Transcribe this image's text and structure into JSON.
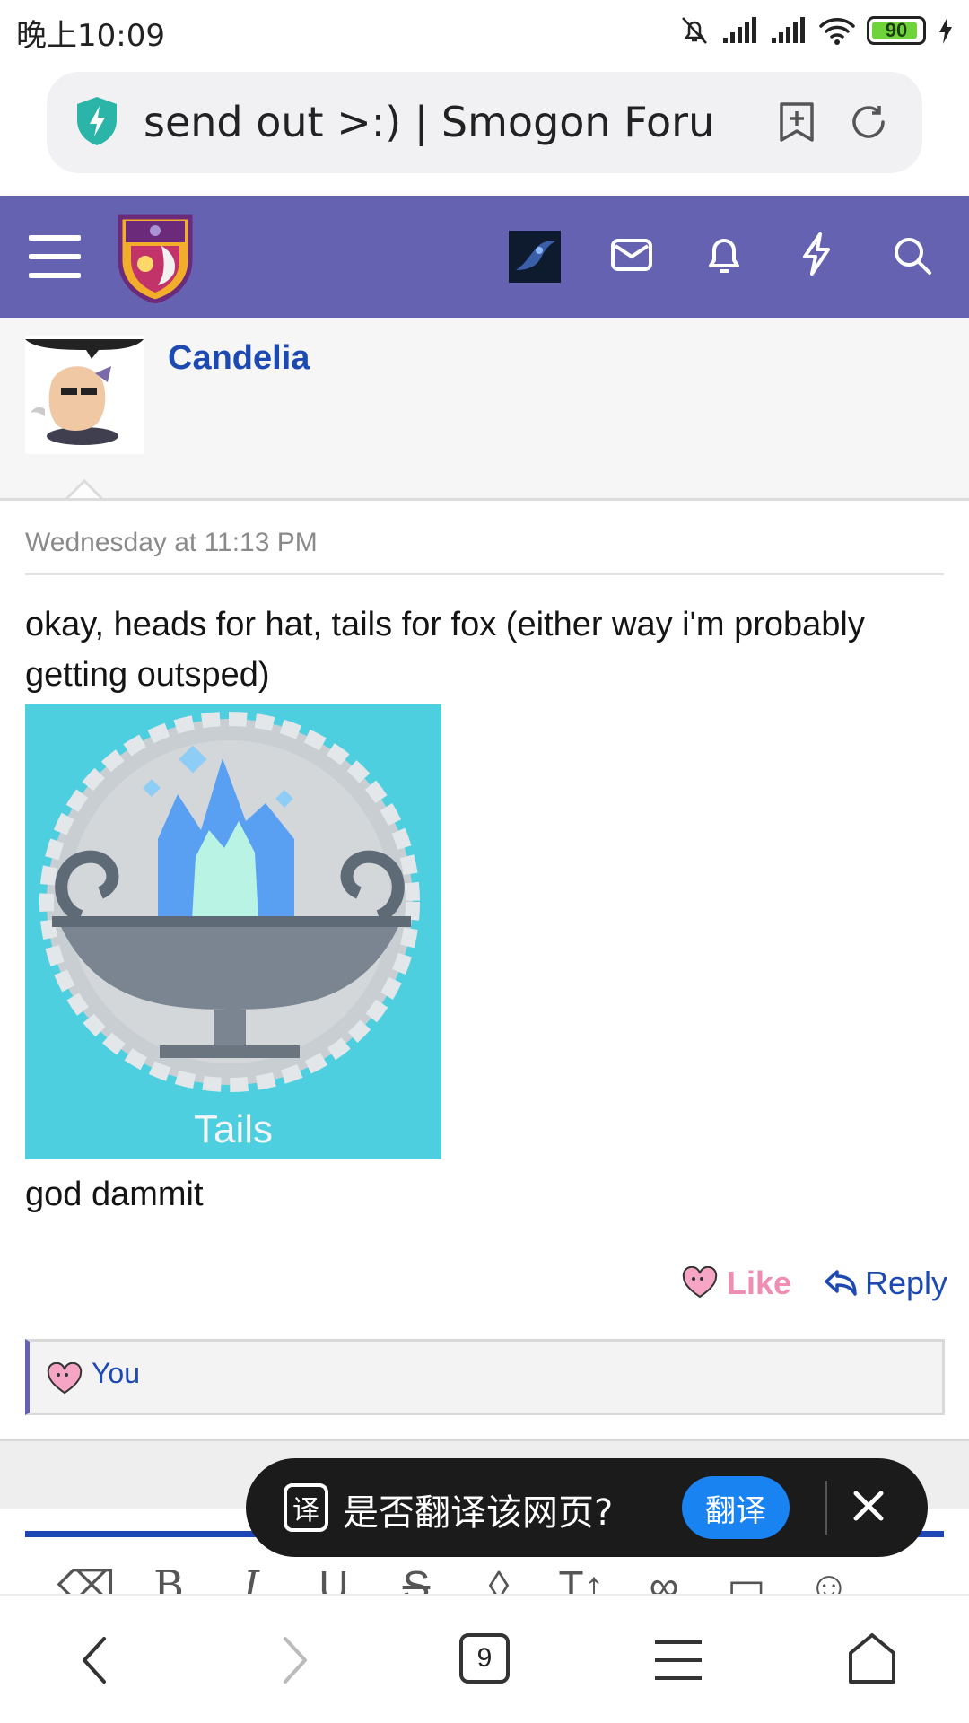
{
  "status_bar": {
    "time": "晚上10:09",
    "battery": "90"
  },
  "browser": {
    "url_title": "send out >:) | Smogon Forum",
    "tab_count": "9"
  },
  "post": {
    "username": "Candelia",
    "timestamp": "Wednesday at 11:13 PM",
    "body": "okay, heads for hat, tails for fox (either way i'm probably getting outsped)",
    "image_label": "Tails",
    "after_text": "god dammit",
    "like_label": "Like",
    "reply_label": "Reply",
    "reactions_text": "You"
  },
  "translate_toast": {
    "prompt": "是否翻译该网页?",
    "button": "翻译",
    "icon_char": "译"
  },
  "editor": {
    "tools": [
      "eraser-icon",
      "bold",
      "italic",
      "underline",
      "strikethrough",
      "color-icon",
      "text-size-icon",
      "link-icon",
      "image-icon",
      "smile-icon"
    ]
  },
  "colors": {
    "nav": "#6563b1",
    "link": "#1c4ab2",
    "like": "#f08db3",
    "coin_bg": "#4dcfe0",
    "translate_button": "#1a83f2"
  }
}
